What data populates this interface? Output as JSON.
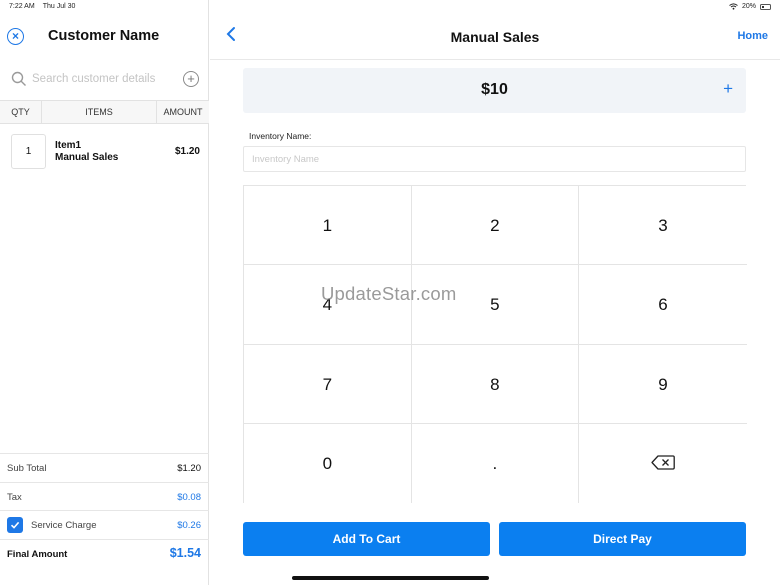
{
  "status_bar": {
    "time": "7:22 AM",
    "date": "Thu Jul 30",
    "battery": "20%"
  },
  "customer_panel": {
    "title": "Customer Name",
    "search_placeholder": "Search customer details",
    "columns": {
      "qty": "QTY",
      "items": "ITEMS",
      "amount": "AMOUNT"
    },
    "items": [
      {
        "qty": "1",
        "name": "Item1",
        "subtitle": "Manual Sales",
        "amount": "$1.20"
      }
    ],
    "totals": {
      "subtotal_label": "Sub Total",
      "subtotal_value": "$1.20",
      "tax_label": "Tax",
      "tax_value": "$0.08",
      "service_charge_label": "Service Charge",
      "service_charge_value": "$0.26",
      "service_charge_checked": true,
      "final_label": "Final Amount",
      "final_value": "$1.54"
    }
  },
  "sales_panel": {
    "title": "Manual Sales",
    "home_label": "Home",
    "amount": "$10",
    "inventory_label": "Inventory Name:",
    "inventory_placeholder": "Inventory Name",
    "keys": [
      "1",
      "2",
      "3",
      "4",
      "5",
      "6",
      "7",
      "8",
      "9",
      "0",
      "."
    ],
    "add_to_cart_label": "Add To Cart",
    "direct_pay_label": "Direct Pay"
  },
  "watermark": "UpdateStar.com",
  "colors": {
    "accent": "#1e78e6",
    "button": "#0b7ff0",
    "amount_bg": "#f1f4f8"
  },
  "icons": [
    "close-circle-icon",
    "search-icon",
    "add-circle-icon",
    "back-chevron-icon",
    "plus-icon",
    "backspace-icon",
    "checkmark-icon",
    "wifi-icon",
    "battery-icon"
  ]
}
